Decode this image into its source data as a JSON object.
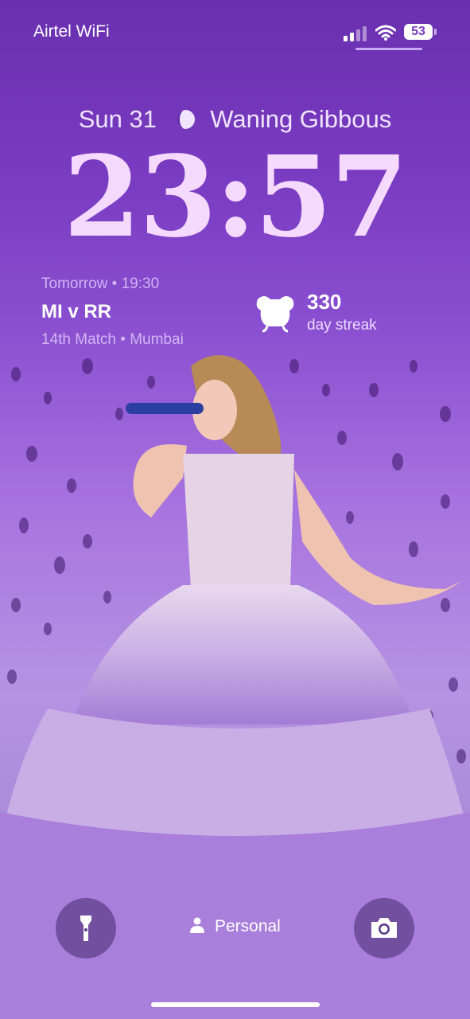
{
  "status_bar": {
    "carrier": "Airtel WiFi",
    "battery": "53"
  },
  "lock_screen": {
    "date": "Sun 31",
    "moon_phase": "Waning Gibbous",
    "time": "23:57"
  },
  "widgets": {
    "match": {
      "when": "Tomorrow • 19:30",
      "title": "MI v RR",
      "venue": "14th Match • Mumbai"
    },
    "streak": {
      "count": "330",
      "label": "day streak"
    }
  },
  "focus": {
    "label": "Personal"
  },
  "icons": [
    "flashlight-icon",
    "camera-icon",
    "person-icon",
    "moon-icon",
    "signal-icon",
    "wifi-icon",
    "battery-icon",
    "streak-mascot-icon"
  ],
  "colors": {
    "accent": "#7a3cc2",
    "clock": "#f6d9ff"
  }
}
